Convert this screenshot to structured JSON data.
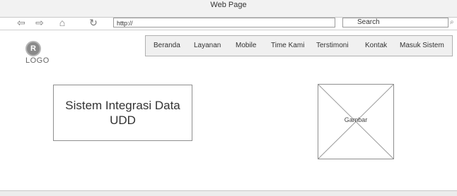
{
  "browser": {
    "window_title": "Web Page",
    "back_icon": "back-arrow-icon",
    "forward_icon": "forward-arrow-icon",
    "home_icon": "home-icon",
    "reload_icon": "reload-icon",
    "url": "http://",
    "search_placeholder": "Search",
    "search_icon": "search-icon"
  },
  "logo": {
    "mark": "R",
    "text": "LOGO"
  },
  "menu": {
    "items": [
      "Beranda",
      "Layanan",
      "Mobile",
      "Time Kami",
      "Terstimoni",
      "Kontak",
      "Masuk Sistem"
    ]
  },
  "hero": {
    "title": "Sistem Integrasi Data UDD"
  },
  "image_placeholder": {
    "label": "Gambar"
  }
}
